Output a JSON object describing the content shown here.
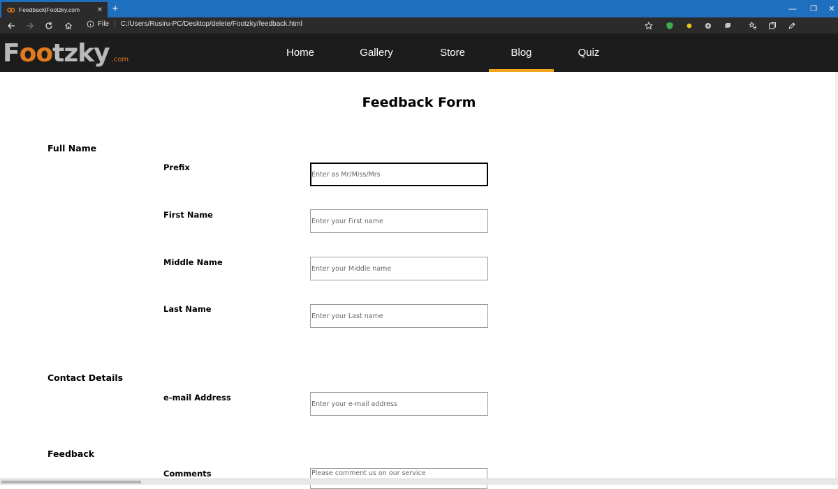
{
  "browser": {
    "tab_title": "Feedback|Footzky.com",
    "tab_close": "✕",
    "new_tab": "+",
    "url_prefix": "File",
    "url": "C:/Users/Rusiru-PC/Desktop/delete/Footzky/feedback.html",
    "minimize": "—",
    "restore": "❐",
    "close": "✕",
    "menu": "···"
  },
  "site": {
    "logo_part1": "F",
    "logo_part2": "oo",
    "logo_part3": "tzky",
    "logo_domain": ".com",
    "accent_color": "#f2a51a",
    "nav": [
      {
        "label": "Home"
      },
      {
        "label": "Gallery"
      },
      {
        "label": "Store"
      },
      {
        "label": "Blog"
      },
      {
        "label": "Quiz"
      }
    ],
    "active_nav": "Blog"
  },
  "form": {
    "title": "Feedback Form",
    "sections": {
      "full_name": "Full Name",
      "contact": "Contact Details",
      "feedback": "Feedback"
    },
    "fields": {
      "prefix": {
        "label": "Prefix",
        "placeholder": "Enter as Mr/Miss/Mrs"
      },
      "first_name": {
        "label": "First Name",
        "placeholder": "Enter your First name"
      },
      "middle_name": {
        "label": "Middle Name",
        "placeholder": "Enter your Middle name"
      },
      "last_name": {
        "label": "Last Name",
        "placeholder": "Enter your Last name"
      },
      "email": {
        "label": "e-mail Address",
        "placeholder": "Enter your e-mail address"
      },
      "comments": {
        "label": "Comments",
        "placeholder": "Please comment us on our service"
      }
    }
  }
}
